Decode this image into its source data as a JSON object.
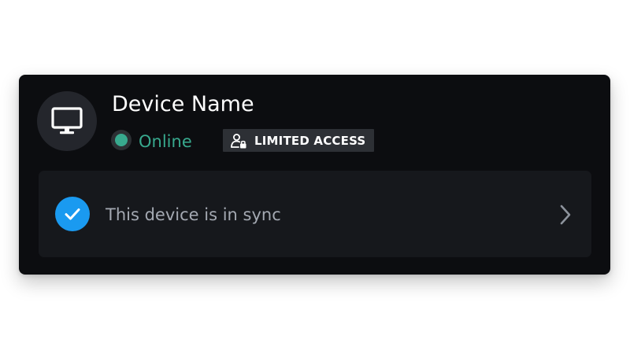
{
  "device": {
    "icon": "monitor-icon",
    "name": "Device Name"
  },
  "status": {
    "label": "Online",
    "color": "#38a98e"
  },
  "access_badge": {
    "icon": "user-lock-icon",
    "label": "LIMITED ACCESS"
  },
  "sync": {
    "icon": "checkmark-icon",
    "icon_color": "#1a9af0",
    "message": "This device is in sync",
    "chevron": "chevron-right-icon"
  }
}
